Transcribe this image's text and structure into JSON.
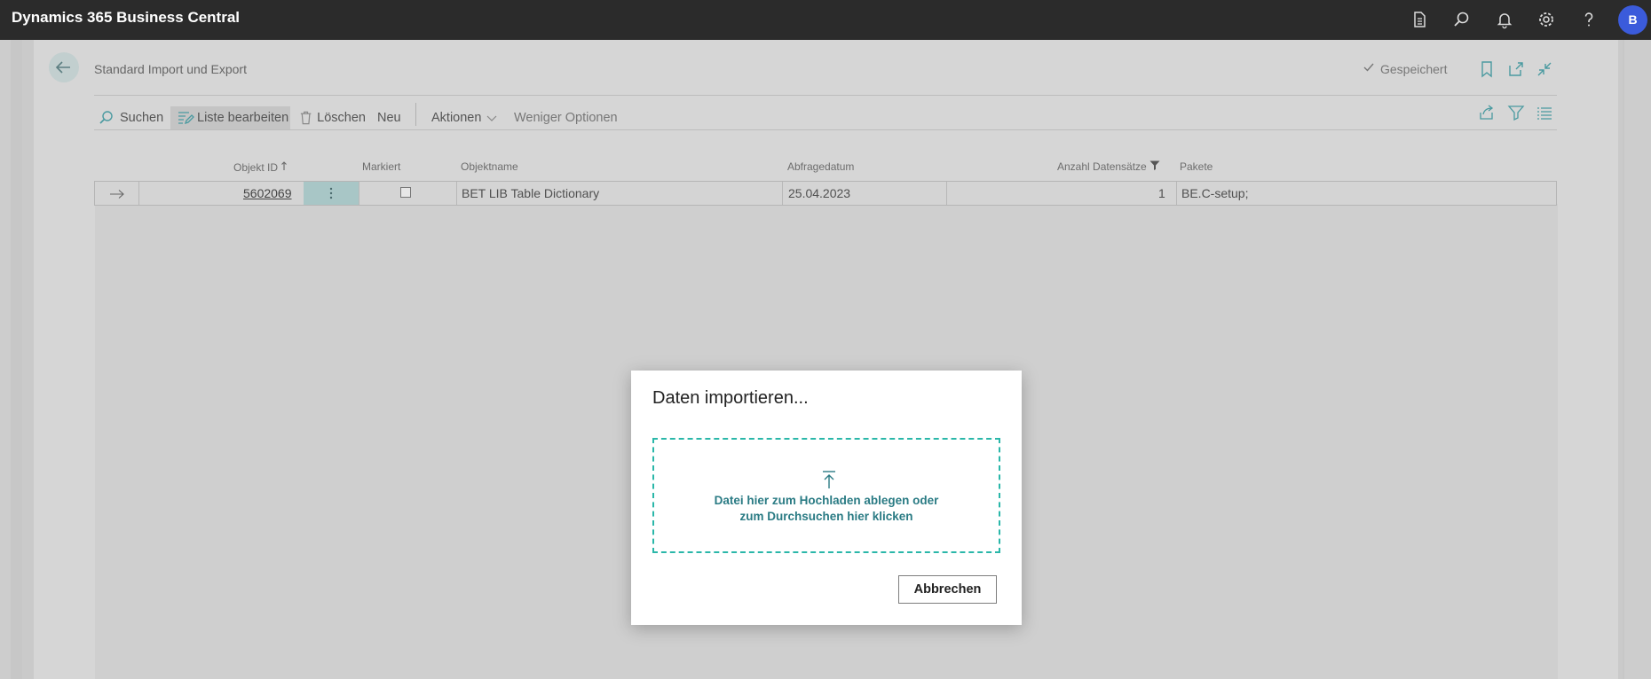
{
  "app": {
    "title": "Dynamics 365 Business Central",
    "avatar_initial": "B"
  },
  "topbar_icons": [
    "document-icon",
    "search-icon",
    "bell-icon",
    "gear-icon",
    "help-icon"
  ],
  "page": {
    "title": "Standard Import und Export",
    "saved_status": "Gespeichert"
  },
  "toolbar": {
    "search": "Suchen",
    "edit_list": "Liste bearbeiten",
    "delete": "Löschen",
    "new": "Neu",
    "actions": "Aktionen",
    "fewer_options": "Weniger Optionen"
  },
  "table": {
    "columns": {
      "objekt_id": "Objekt ID",
      "markiert": "Markiert",
      "objektname": "Objektname",
      "abfragedatum": "Abfragedatum",
      "anzahl": "Anzahl Datensätze",
      "pakete": "Pakete"
    },
    "rows": [
      {
        "objekt_id": "5602069",
        "markiert": false,
        "objektname": "BET LIB Table Dictionary",
        "abfragedatum": "25.04.2023",
        "anzahl": "1",
        "pakete": "BE.C-setup;"
      }
    ]
  },
  "dialog": {
    "title": "Daten importieren...",
    "dropzone_line1": "Datei hier zum Hochladen ablegen oder",
    "dropzone_line2": "zum Durchsuchen hier klicken",
    "cancel": "Abbrechen"
  },
  "colors": {
    "accent": "#2ab7a9",
    "topbar": "#2b2b2b",
    "avatar": "#3b5bdb"
  }
}
